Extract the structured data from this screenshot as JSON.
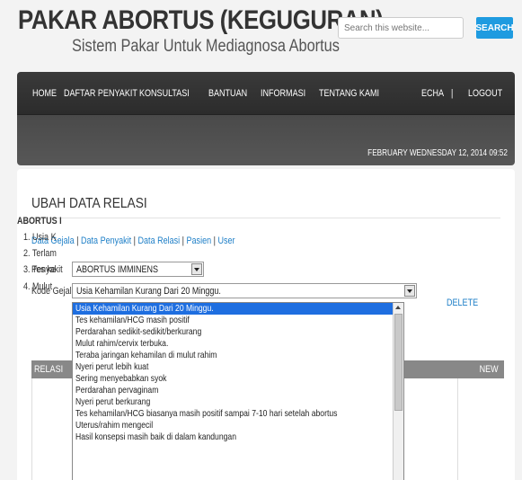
{
  "header": {
    "title": "PAKAR ABORTUS (KEGUGURAN)",
    "subtitle": "Sistem Pakar Untuk Mediagnosa Abortus",
    "search_placeholder": "Search this website...",
    "search_button": "SEARCH"
  },
  "nav": {
    "items": [
      "HOME",
      "DAFTAR PENYAKIT",
      "KONSULTASI",
      "BANTUAN",
      "INFORMASI",
      "TENTANG KAMI"
    ],
    "user": "ECHA",
    "separator": "|",
    "logout": "LOGOUT",
    "datetime": "FEBRUARY  WEDNESDAY  12, 2014 09:52"
  },
  "page": {
    "heading": "UBAH DATA RELASI",
    "links": [
      "Data Gejala",
      "Data Penyakit",
      "Data Relasi",
      "Pasien",
      "User"
    ],
    "link_separator": " | "
  },
  "form": {
    "penyakit_label": "Penyakit",
    "penyakit_value": "ABORTUS IMMINENS",
    "kode_label": "Kode Gejala",
    "kode_value": "Usia Kehamilan Kurang Dari 20 Minggu."
  },
  "dropdown": {
    "selected_index": 0,
    "options": [
      "Usia Kehamilan Kurang Dari 20 Minggu.",
      "Tes kehamilan/HCG masih positif",
      "Perdarahan sedikit-sedikit/berkurang",
      "Mulut rahim/cervix terbuka.",
      "Teraba jaringan kehamilan di mulut rahim",
      "Nyeri perut lebih kuat",
      "Sering menyebabkan syok",
      "Perdarahan pervaginam",
      "Nyeri perut berkurang",
      "Tes kehamilan/HCG biasanya masih positif sampai 7-10 hari setelah abortus",
      "Uterus/rahim mengecil",
      "Hasil konsepsi masih baik di dalam kandungan"
    ]
  },
  "table": {
    "header_left": "RELASI",
    "header_right": "NEW",
    "title": "ABORTUS I",
    "rows": [
      "1.  Usia K",
      "2.  Terlam",
      "3.  Tes ke",
      "4.  Mulut"
    ],
    "delete_label": "DELETE"
  },
  "colors": {
    "accent": "#1e9be0",
    "link": "#1e7fc7",
    "nav_bg": "#2c2c2c",
    "selected": "#1e6ee0"
  }
}
